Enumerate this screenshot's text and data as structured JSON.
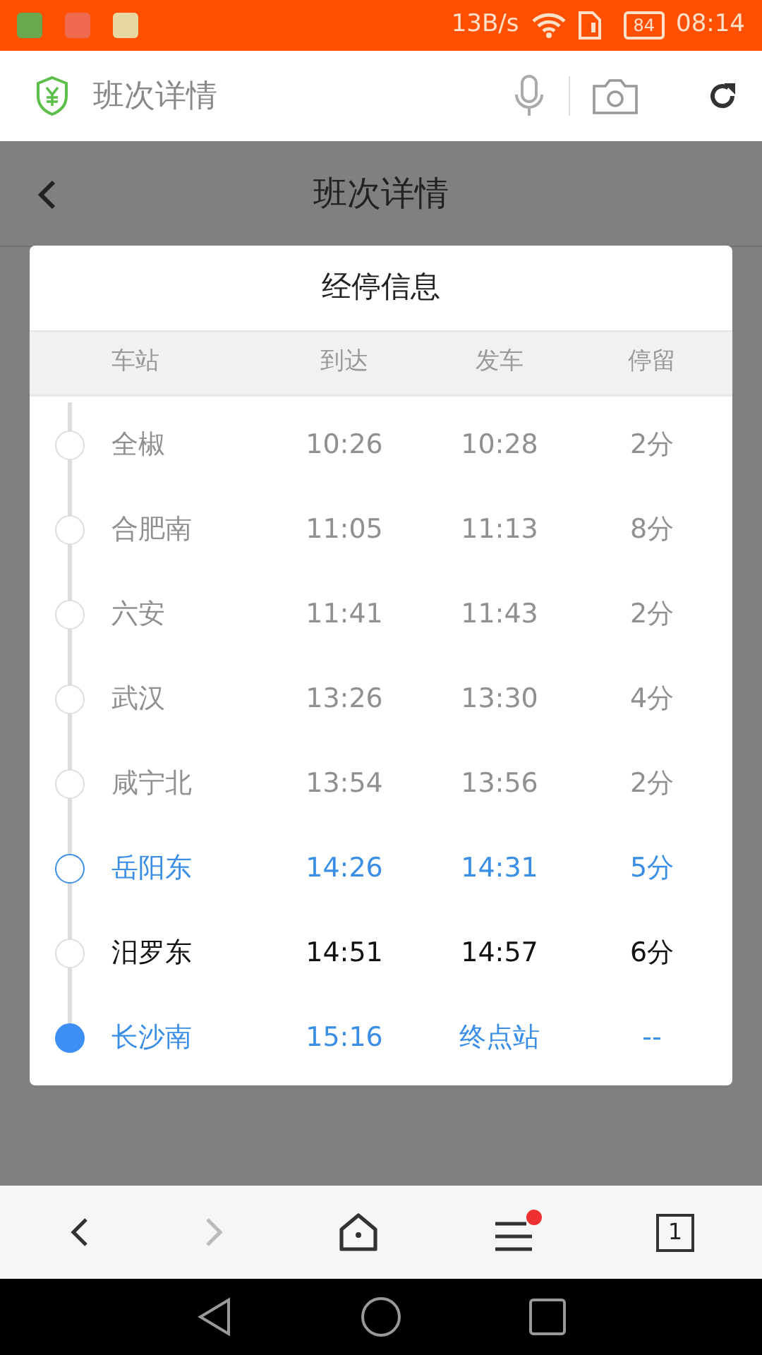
{
  "status_bar": {
    "speed": "13B/s",
    "battery": "84",
    "time": "08:14"
  },
  "browser_bar": {
    "title": "班次详情"
  },
  "page_header": {
    "title": "班次详情"
  },
  "dialog": {
    "title": "经停信息",
    "columns": [
      "车站",
      "到达",
      "发车",
      "停留"
    ],
    "stops": [
      {
        "kind": "passed",
        "station": "全椒",
        "arrive": "10:26",
        "depart": "10:28",
        "stay": "2分"
      },
      {
        "kind": "passed",
        "station": "合肥南",
        "arrive": "11:05",
        "depart": "11:13",
        "stay": "8分"
      },
      {
        "kind": "passed",
        "station": "六安",
        "arrive": "11:41",
        "depart": "11:43",
        "stay": "2分"
      },
      {
        "kind": "passed",
        "station": "武汉",
        "arrive": "13:26",
        "depart": "13:30",
        "stay": "4分"
      },
      {
        "kind": "passed",
        "station": "咸宁北",
        "arrive": "13:54",
        "depart": "13:56",
        "stay": "2分"
      },
      {
        "kind": "boarding",
        "station": "岳阳东",
        "arrive": "14:26",
        "depart": "14:31",
        "stay": "5分"
      },
      {
        "kind": "upcoming",
        "station": "汨罗东",
        "arrive": "14:51",
        "depart": "14:57",
        "stay": "6分"
      },
      {
        "kind": "terminal",
        "station": "长沙南",
        "arrive": "15:16",
        "depart": "终点站",
        "stay": "--"
      }
    ]
  },
  "bottom_nav": {
    "tab_count": "1",
    "menu_badge": true
  }
}
